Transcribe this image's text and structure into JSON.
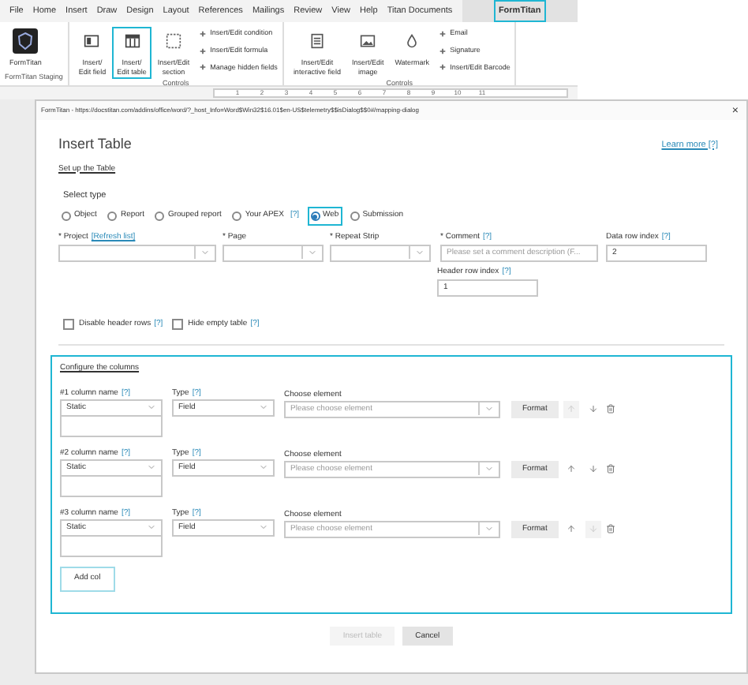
{
  "menu_tabs": [
    {
      "label": "File",
      "selected": false
    },
    {
      "label": "Home",
      "selected": false
    },
    {
      "label": "Insert",
      "selected": false
    },
    {
      "label": "Draw",
      "selected": false
    },
    {
      "label": "Design",
      "selected": false
    },
    {
      "label": "Layout",
      "selected": false
    },
    {
      "label": "References",
      "selected": false
    },
    {
      "label": "Mailings",
      "selected": false
    },
    {
      "label": "Review",
      "selected": false
    },
    {
      "label": "View",
      "selected": false
    },
    {
      "label": "Help",
      "selected": false
    },
    {
      "label": "Titan Documents",
      "selected": false
    },
    {
      "label": "FormTitan",
      "selected": true
    }
  ],
  "ribbon": {
    "groups": [
      {
        "label": "FormTitan Staging",
        "large": [
          {
            "label": "FormTitan",
            "selected": false
          }
        ]
      },
      {
        "label": "Controls",
        "large": [
          {
            "label": "Insert/\nEdit field",
            "selected": false
          },
          {
            "label": "Insert/\nEdit table",
            "selected": true
          },
          {
            "label": "Insert/Edit\nsection",
            "selected": false
          }
        ],
        "small": [
          "Insert/Edit condition",
          "Insert/Edit formula",
          "Manage hidden fields"
        ]
      },
      {
        "label": "Controls",
        "large": [
          {
            "label": "Insert/Edit\ninteractive field",
            "selected": false
          },
          {
            "label": "Insert/Edit\nimage",
            "selected": false
          },
          {
            "label": "Watermark",
            "selected": false
          }
        ],
        "small": [
          "Email",
          "Signature",
          "Insert/Edit Barcode"
        ]
      }
    ]
  },
  "ruler": {
    "numbers": [
      "1",
      "2",
      "3",
      "4",
      "5",
      "6",
      "7",
      "8",
      "9",
      "10",
      "11"
    ]
  },
  "dialog": {
    "url": "FormTitan - https://docstitan.com/addins/office/word/?_host_Info=Word$Win32$16.01$en-US$telemetry$$isDialog$$0#/mapping-dialog",
    "close": "×",
    "title": "Insert Table",
    "learn_more": "Learn more [?]",
    "section_link": "Set up the Table",
    "select_type_label": "Select type",
    "types": [
      {
        "label": "Object",
        "selected": false
      },
      {
        "label": "Report",
        "selected": false
      },
      {
        "label": "Grouped report",
        "selected": false
      },
      {
        "label": "Your APEX",
        "help": "[?]",
        "selected": false
      },
      {
        "label": "Web",
        "selected": true
      },
      {
        "label": "Submission",
        "selected": false
      }
    ],
    "fields": [
      {
        "kind": "select",
        "label": "* Project",
        "link": "[Refresh list]"
      },
      {
        "kind": "select",
        "label": "* Page"
      },
      {
        "kind": "select",
        "label": "* Repeat Strip"
      },
      {
        "kind": "text",
        "label": "* Comment",
        "help": "[?]",
        "placeholder": "Please set a comment description (F..."
      },
      {
        "kind": "text",
        "label": "Data row index",
        "help": "[?]",
        "value": "2"
      }
    ],
    "header_row": {
      "label": "Header row index",
      "help": "[?]",
      "value": "1"
    },
    "options": [
      {
        "label": "Disable header rows",
        "help": "[?]",
        "checked": false
      },
      {
        "label": "Hide empty table",
        "help": "[?]",
        "checked": false
      }
    ],
    "columns": {
      "title": "Configure the columns",
      "rows": [
        {
          "name_label": "#1 column name",
          "name_help": "[?]",
          "name_value": "Static",
          "type_label": "Type",
          "type_help": "[?]",
          "type_value": "Field",
          "element_label": "Choose element",
          "element_placeholder": "Please choose element",
          "format": "Format",
          "up_disabled": true,
          "down_disabled": false
        },
        {
          "name_label": "#2 column name",
          "name_help": "[?]",
          "name_value": "Static",
          "type_label": "Type",
          "type_help": "[?]",
          "type_value": "Field",
          "element_label": "Choose element",
          "element_placeholder": "Please choose element",
          "format": "Format",
          "up_disabled": false,
          "down_disabled": false
        },
        {
          "name_label": "#3 column name",
          "name_help": "[?]",
          "name_value": "Static",
          "type_label": "Type",
          "type_help": "[?]",
          "type_value": "Field",
          "element_label": "Choose element",
          "element_placeholder": "Please choose element",
          "format": "Format",
          "up_disabled": false,
          "down_disabled": true
        }
      ],
      "add": "Add col"
    },
    "buttons": [
      {
        "label": "Insert table",
        "disabled": true
      },
      {
        "label": "Cancel",
        "disabled": false
      }
    ]
  }
}
